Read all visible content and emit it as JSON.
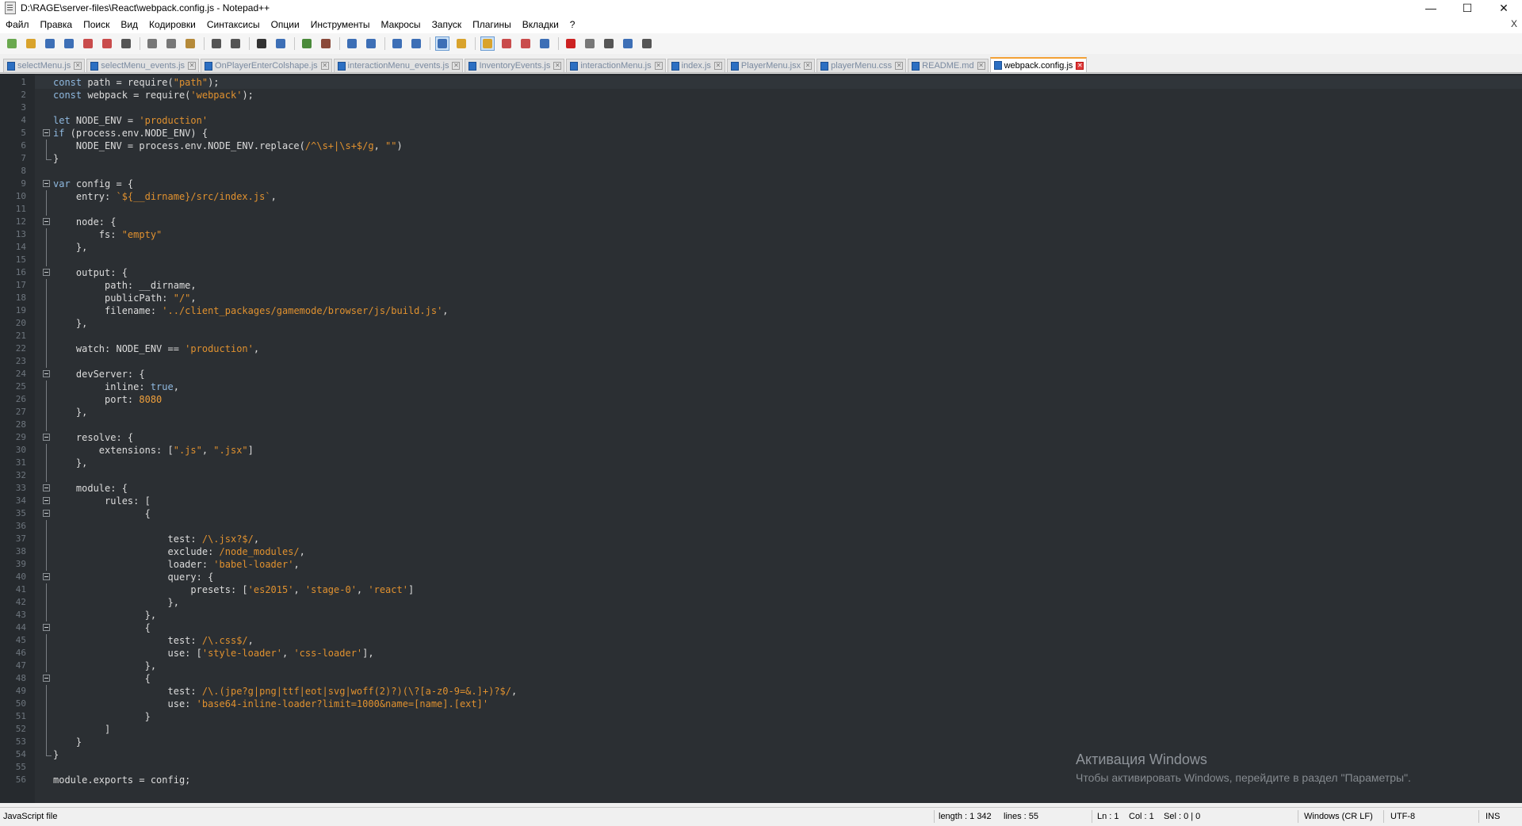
{
  "window": {
    "title": "D:\\RAGE\\server-files\\React\\webpack.config.js - Notepad++",
    "minimize": "—",
    "maximize": "☐",
    "close": "✕"
  },
  "menu": {
    "items": [
      "Файл",
      "Правка",
      "Поиск",
      "Вид",
      "Кодировки",
      "Синтаксисы",
      "Опции",
      "Инструменты",
      "Макросы",
      "Запуск",
      "Плагины",
      "Вкладки",
      "?"
    ],
    "close_doc": "X"
  },
  "toolbar": {
    "buttons": [
      {
        "icon": "new-file-icon",
        "color": "#6aa84f"
      },
      {
        "icon": "open-file-icon",
        "color": "#d9a32c"
      },
      {
        "icon": "save-icon",
        "color": "#3d6fb6"
      },
      {
        "icon": "save-all-icon",
        "color": "#3d6fb6"
      },
      {
        "icon": "close-file-icon",
        "color": "#c94c4c"
      },
      {
        "icon": "close-all-icon",
        "color": "#c94c4c"
      },
      {
        "icon": "print-icon",
        "color": "#555555"
      },
      {
        "icon": "cut-icon",
        "color": "#777777"
      },
      {
        "icon": "copy-icon",
        "color": "#777777"
      },
      {
        "icon": "paste-icon",
        "color": "#b58a3a"
      },
      {
        "icon": "undo-icon",
        "color": "#555555"
      },
      {
        "icon": "redo-icon",
        "color": "#555555"
      },
      {
        "icon": "find-icon",
        "color": "#333333"
      },
      {
        "icon": "replace-icon",
        "color": "#3d6fb6"
      },
      {
        "icon": "zoom-in-icon",
        "color": "#4a8a3a"
      },
      {
        "icon": "zoom-out-icon",
        "color": "#8a4a3a"
      },
      {
        "icon": "sync-vertical-icon",
        "color": "#3d6fb6"
      },
      {
        "icon": "sync-horizontal-icon",
        "color": "#3d6fb6"
      },
      {
        "icon": "word-wrap-icon",
        "color": "#3d6fb6"
      },
      {
        "icon": "show-all-chars-icon",
        "color": "#3d6fb6"
      },
      {
        "icon": "indent-guide-icon",
        "color": "#3d6fb6",
        "active": true
      },
      {
        "icon": "user-language-icon",
        "color": "#d9a32c"
      },
      {
        "icon": "doc-map-icon",
        "color": "#d9a32c",
        "active": true
      },
      {
        "icon": "function-list-icon",
        "color": "#c94c4c"
      },
      {
        "icon": "folder-workspace-icon",
        "color": "#c94c4c"
      },
      {
        "icon": "monitoring-icon",
        "color": "#3d6fb6"
      },
      {
        "icon": "record-macro-icon",
        "color": "#cc2222"
      },
      {
        "icon": "stop-macro-icon",
        "color": "#777777"
      },
      {
        "icon": "play-macro-icon",
        "color": "#555555"
      },
      {
        "icon": "run-macro-multiple-icon",
        "color": "#3d6fb6"
      },
      {
        "icon": "save-macro-icon",
        "color": "#555555"
      }
    ]
  },
  "tabs": [
    {
      "label": "selectMenu.js",
      "active": false
    },
    {
      "label": "selectMenu_events.js",
      "active": false
    },
    {
      "label": "OnPlayerEnterColshape.js",
      "active": false
    },
    {
      "label": "interactionMenu_events.js",
      "active": false
    },
    {
      "label": "InventoryEvents.js",
      "active": false
    },
    {
      "label": "interactionMenu.js",
      "active": false
    },
    {
      "label": "index.js",
      "active": false
    },
    {
      "label": "PlayerMenu.jsx",
      "active": false
    },
    {
      "label": "playerMenu.css",
      "active": false
    },
    {
      "label": "README.md",
      "active": false
    },
    {
      "label": "webpack.config.js",
      "active": true
    }
  ],
  "editor": {
    "lines": [
      {
        "n": "1",
        "t": [
          [
            "k",
            "const"
          ],
          [
            "p",
            " path = require("
          ],
          [
            "s",
            "\"path\""
          ],
          [
            "p",
            ");"
          ]
        ]
      },
      {
        "n": "2",
        "t": [
          [
            "k",
            "const"
          ],
          [
            "p",
            " webpack = require("
          ],
          [
            "s",
            "'webpack'"
          ],
          [
            "p",
            ");"
          ]
        ]
      },
      {
        "n": "3",
        "t": []
      },
      {
        "n": "4",
        "t": [
          [
            "k",
            "let"
          ],
          [
            "p",
            " NODE_ENV = "
          ],
          [
            "s",
            "'production'"
          ]
        ]
      },
      {
        "n": "5",
        "t": [
          [
            "k",
            "if"
          ],
          [
            "p",
            " (process.env.NODE_ENV) {"
          ]
        ],
        "fold": "m"
      },
      {
        "n": "6",
        "t": [
          [
            "p",
            "    NODE_ENV = process.env.NODE_ENV.replace("
          ],
          [
            "s",
            "/^\\s+|\\s+$/g"
          ],
          [
            "p",
            ", "
          ],
          [
            "s",
            "\"\""
          ],
          [
            "p",
            ")"
          ]
        ],
        "fold": "l"
      },
      {
        "n": "7",
        "t": [
          [
            "p",
            "}"
          ]
        ],
        "fold": "e"
      },
      {
        "n": "8",
        "t": []
      },
      {
        "n": "9",
        "t": [
          [
            "k",
            "var"
          ],
          [
            "p",
            " config = {"
          ]
        ],
        "fold": "m"
      },
      {
        "n": "10",
        "t": [
          [
            "p",
            "    entry: "
          ],
          [
            "s",
            "`${__dirname}/src/index.js`"
          ],
          [
            "p",
            ","
          ]
        ],
        "fold": "l"
      },
      {
        "n": "11",
        "t": [],
        "fold": "l"
      },
      {
        "n": "12",
        "t": [
          [
            "p",
            "    node: {"
          ]
        ],
        "fold": "m"
      },
      {
        "n": "13",
        "t": [
          [
            "p",
            "        fs: "
          ],
          [
            "s",
            "\"empty\""
          ]
        ],
        "fold": "l"
      },
      {
        "n": "14",
        "t": [
          [
            "p",
            "    },"
          ]
        ],
        "fold": "l"
      },
      {
        "n": "15",
        "t": [],
        "fold": "l"
      },
      {
        "n": "16",
        "t": [
          [
            "p",
            "    output: {"
          ]
        ],
        "fold": "m"
      },
      {
        "n": "17",
        "t": [
          [
            "p",
            "         path: __dirname,"
          ]
        ],
        "fold": "l"
      },
      {
        "n": "18",
        "t": [
          [
            "p",
            "         publicPath: "
          ],
          [
            "s",
            "\"/\""
          ],
          [
            "p",
            ","
          ]
        ],
        "fold": "l"
      },
      {
        "n": "19",
        "t": [
          [
            "p",
            "         filename: "
          ],
          [
            "s",
            "'../client_packages/gamemode/browser/js/build.js'"
          ],
          [
            "p",
            ","
          ]
        ],
        "fold": "l"
      },
      {
        "n": "20",
        "t": [
          [
            "p",
            "    },"
          ]
        ],
        "fold": "l"
      },
      {
        "n": "21",
        "t": [],
        "fold": "l"
      },
      {
        "n": "22",
        "t": [
          [
            "p",
            "    watch: NODE_ENV == "
          ],
          [
            "s",
            "'production'"
          ],
          [
            "p",
            ","
          ]
        ],
        "fold": "l"
      },
      {
        "n": "23",
        "t": [],
        "fold": "l"
      },
      {
        "n": "24",
        "t": [
          [
            "p",
            "    devServer: {"
          ]
        ],
        "fold": "m"
      },
      {
        "n": "25",
        "t": [
          [
            "p",
            "         inline: "
          ],
          [
            "k",
            "true"
          ],
          [
            "p",
            ","
          ]
        ],
        "fold": "l"
      },
      {
        "n": "26",
        "t": [
          [
            "p",
            "         port: "
          ],
          [
            "n",
            "8080"
          ]
        ],
        "fold": "l"
      },
      {
        "n": "27",
        "t": [
          [
            "p",
            "    },"
          ]
        ],
        "fold": "l"
      },
      {
        "n": "28",
        "t": [],
        "fold": "l"
      },
      {
        "n": "29",
        "t": [
          [
            "p",
            "    resolve: {"
          ]
        ],
        "fold": "m"
      },
      {
        "n": "30",
        "t": [
          [
            "p",
            "        extensions: ["
          ],
          [
            "s",
            "\".js\""
          ],
          [
            "p",
            ", "
          ],
          [
            "s",
            "\".jsx\""
          ],
          [
            "p",
            "]"
          ]
        ],
        "fold": "l"
      },
      {
        "n": "31",
        "t": [
          [
            "p",
            "    },"
          ]
        ],
        "fold": "l"
      },
      {
        "n": "32",
        "t": [],
        "fold": "l"
      },
      {
        "n": "33",
        "t": [
          [
            "p",
            "    module: {"
          ]
        ],
        "fold": "m"
      },
      {
        "n": "34",
        "t": [
          [
            "p",
            "         rules: ["
          ]
        ],
        "fold": "m"
      },
      {
        "n": "35",
        "t": [
          [
            "p",
            "                {"
          ]
        ],
        "fold": "m"
      },
      {
        "n": "36",
        "t": [],
        "fold": "l"
      },
      {
        "n": "37",
        "t": [
          [
            "p",
            "                    test: "
          ],
          [
            "s",
            "/\\.jsx?$/"
          ],
          [
            "p",
            ","
          ]
        ],
        "fold": "l"
      },
      {
        "n": "38",
        "t": [
          [
            "p",
            "                    exclude: "
          ],
          [
            "s",
            "/node_modules/"
          ],
          [
            "p",
            ","
          ]
        ],
        "fold": "l"
      },
      {
        "n": "39",
        "t": [
          [
            "p",
            "                    loader: "
          ],
          [
            "s",
            "'babel-loader'"
          ],
          [
            "p",
            ","
          ]
        ],
        "fold": "l"
      },
      {
        "n": "40",
        "t": [
          [
            "p",
            "                    query: {"
          ]
        ],
        "fold": "m"
      },
      {
        "n": "41",
        "t": [
          [
            "p",
            "                        presets: ["
          ],
          [
            "s",
            "'es2015'"
          ],
          [
            "p",
            ", "
          ],
          [
            "s",
            "'stage-0'"
          ],
          [
            "p",
            ", "
          ],
          [
            "s",
            "'react'"
          ],
          [
            "p",
            "]"
          ]
        ],
        "fold": "l"
      },
      {
        "n": "42",
        "t": [
          [
            "p",
            "                    },"
          ]
        ],
        "fold": "l"
      },
      {
        "n": "43",
        "t": [
          [
            "p",
            "                },"
          ]
        ],
        "fold": "l"
      },
      {
        "n": "44",
        "t": [
          [
            "p",
            "                {"
          ]
        ],
        "fold": "m"
      },
      {
        "n": "45",
        "t": [
          [
            "p",
            "                    test: "
          ],
          [
            "s",
            "/\\.css$/"
          ],
          [
            "p",
            ","
          ]
        ],
        "fold": "l"
      },
      {
        "n": "46",
        "t": [
          [
            "p",
            "                    use: ["
          ],
          [
            "s",
            "'style-loader'"
          ],
          [
            "p",
            ", "
          ],
          [
            "s",
            "'css-loader'"
          ],
          [
            "p",
            "],"
          ]
        ],
        "fold": "l"
      },
      {
        "n": "47",
        "t": [
          [
            "p",
            "                },"
          ]
        ],
        "fold": "l"
      },
      {
        "n": "48",
        "t": [
          [
            "p",
            "                {"
          ]
        ],
        "fold": "m"
      },
      {
        "n": "49",
        "t": [
          [
            "p",
            "                    test: "
          ],
          [
            "s",
            "/\\.(jpe?g|png|ttf|eot|svg|woff(2)?)(\\?[a-z0-9=&.]+)?$/"
          ],
          [
            "p",
            ","
          ]
        ],
        "fold": "l"
      },
      {
        "n": "50",
        "t": [
          [
            "p",
            "                    use: "
          ],
          [
            "s",
            "'base64-inline-loader?limit=1000&name=[name].[ext]'"
          ]
        ],
        "fold": "l"
      },
      {
        "n": "51",
        "t": [
          [
            "p",
            "                }"
          ]
        ],
        "fold": "l"
      },
      {
        "n": "52",
        "t": [
          [
            "p",
            "         ]"
          ]
        ],
        "fold": "l"
      },
      {
        "n": "53",
        "t": [
          [
            "p",
            "    }"
          ]
        ],
        "fold": "l"
      },
      {
        "n": "54",
        "t": [
          [
            "p",
            "}"
          ]
        ],
        "fold": "e"
      },
      {
        "n": "55",
        "t": []
      },
      {
        "n": "56",
        "t": [
          [
            "p",
            "module.exports = config;"
          ]
        ]
      }
    ]
  },
  "watermark": {
    "line1": "Активация Windows",
    "line2": "Чтобы активировать Windows, перейдите в раздел \"Параметры\"."
  },
  "status": {
    "filetype": "JavaScript file",
    "length": "length : 1 342",
    "lines": "lines : 55",
    "ln": "Ln : 1",
    "col": "Col : 1",
    "sel": "Sel : 0 | 0",
    "eol": "Windows (CR LF)",
    "encoding": "UTF-8",
    "mode": "INS"
  },
  "colors": {
    "editor_bg": "#2b2f33",
    "keyword": "#8fb9e0",
    "string": "#e0912f",
    "active_tab_accent": "#f3a136"
  }
}
